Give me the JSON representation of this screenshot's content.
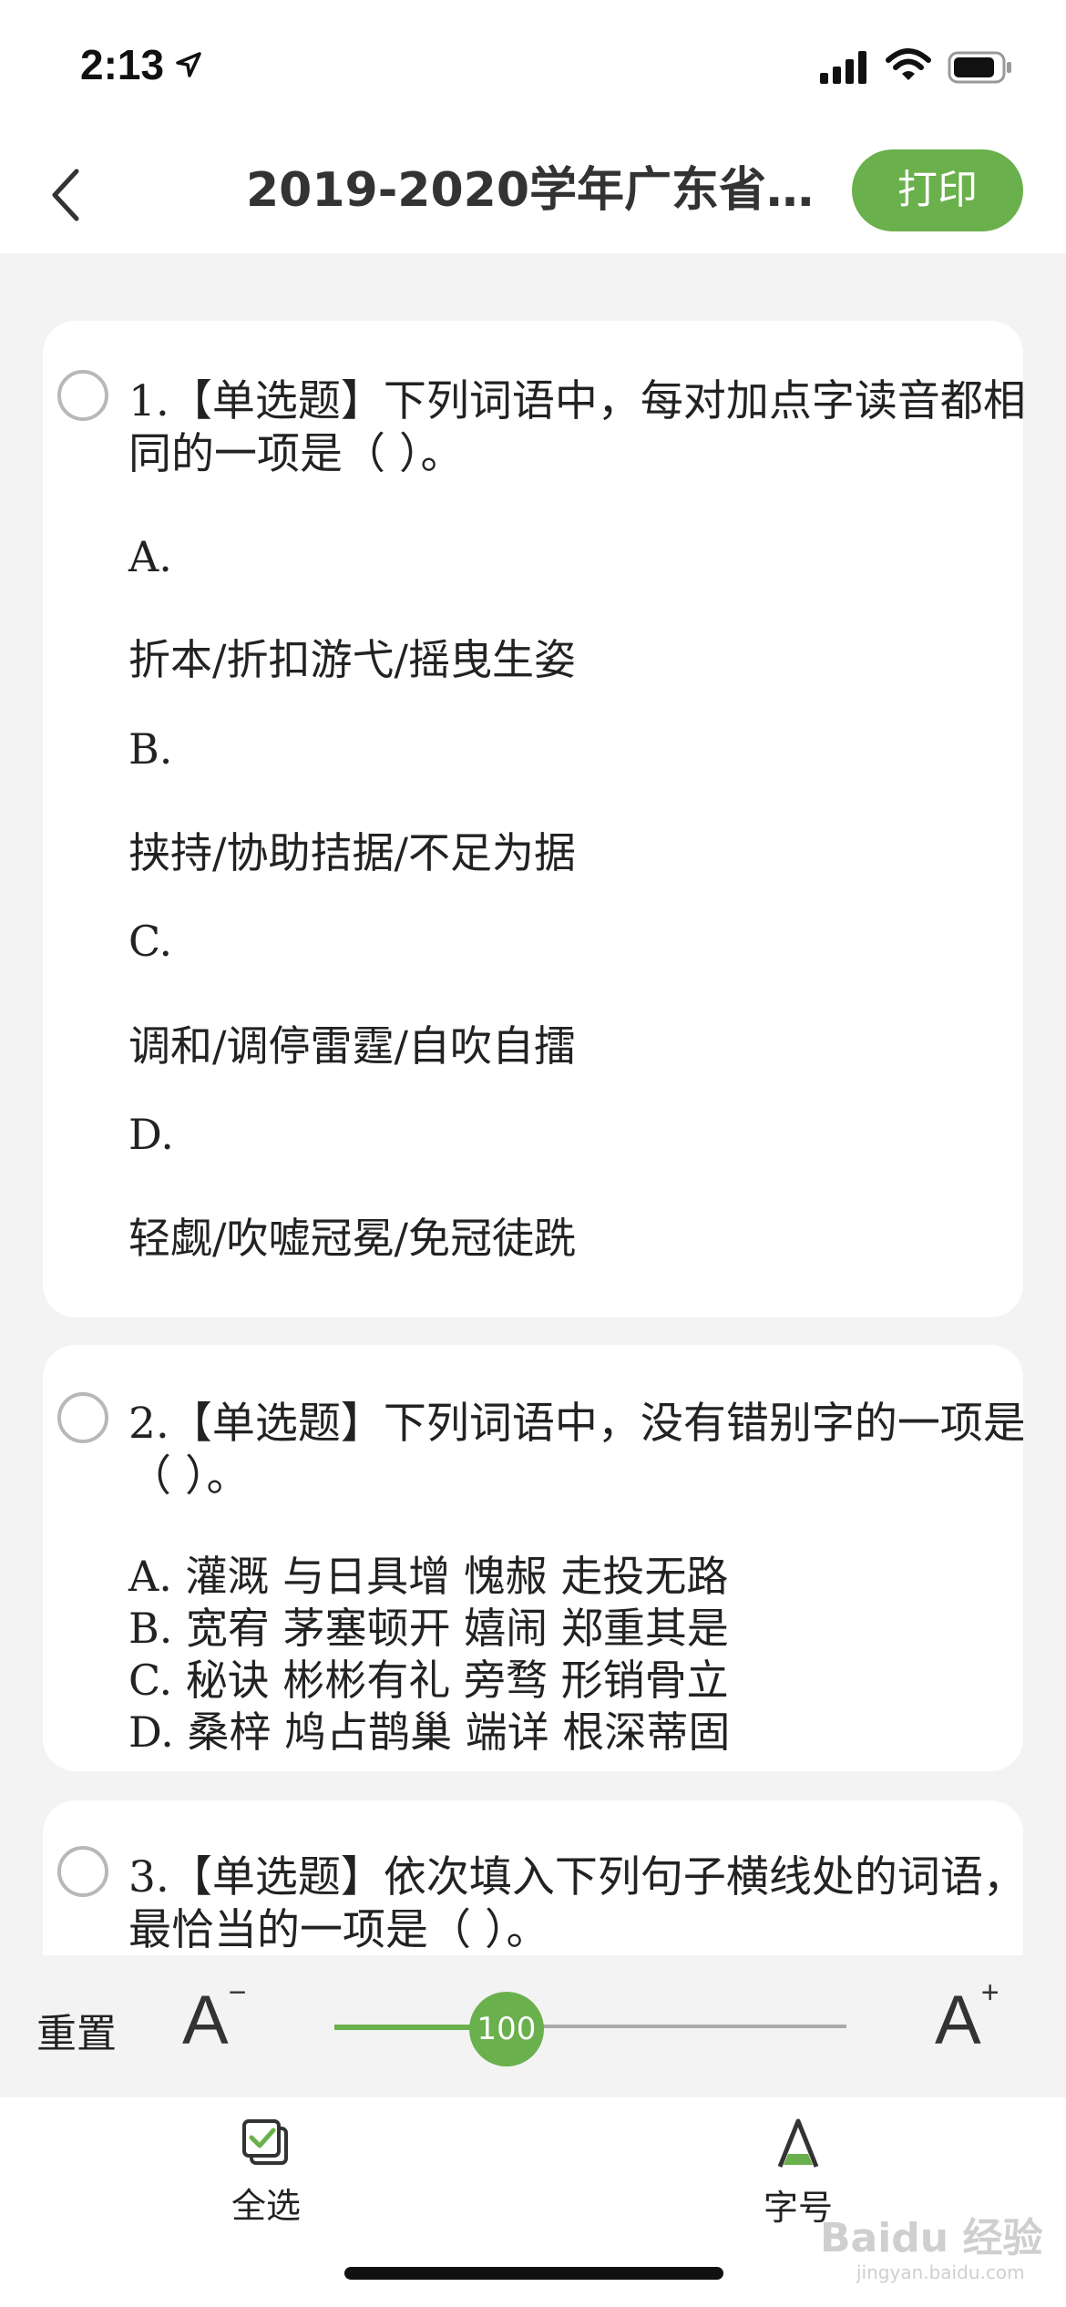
{
  "status_bar": {
    "time": "2:13"
  },
  "nav": {
    "title": "2019-2020学年广东省…",
    "print_label": "打印"
  },
  "questions": [
    {
      "text": "1.【单选题】下列词语中，每对加点字读音都相同的一项是（ ）。",
      "options": [
        {
          "letter": "A.",
          "text": "折本/折扣游弋/摇曳生姿"
        },
        {
          "letter": "B.",
          "text": "挟持/协助拮据/不足为据"
        },
        {
          "letter": "C.",
          "text": "调和/调停雷霆/自吹自擂"
        },
        {
          "letter": "D.",
          "text": "轻觑/吹嘘冠冕/免冠徒跣"
        }
      ]
    },
    {
      "text": "2.【单选题】下列词语中，没有错别字的一项是（ ）。",
      "lines": [
        "A. 灌溉 与日具增 愧赧 走投无路",
        "B. 宽宥 茅塞顿开 嬉闹 郑重其是",
        "C. 秘诀 彬彬有礼 旁骛 形销骨立",
        "D. 桑梓 鸠占鹊巢 端详 根深蒂固"
      ]
    },
    {
      "text": "3.【单选题】依次填入下列句子横线处的词语，最恰当的一项是（ ）。"
    }
  ],
  "toolbar": {
    "reset_label": "重置",
    "font_size_value": "100",
    "decrease_label": "A",
    "increase_label": "A"
  },
  "tabbar": {
    "select_all_label": "全选",
    "font_size_label": "字号"
  },
  "watermark": {
    "main": "Baidu 经验",
    "sub": "jingyan.baidu.com"
  },
  "colors": {
    "accent": "#6ab04c",
    "background": "#f3f3f3",
    "card": "#ffffff"
  }
}
